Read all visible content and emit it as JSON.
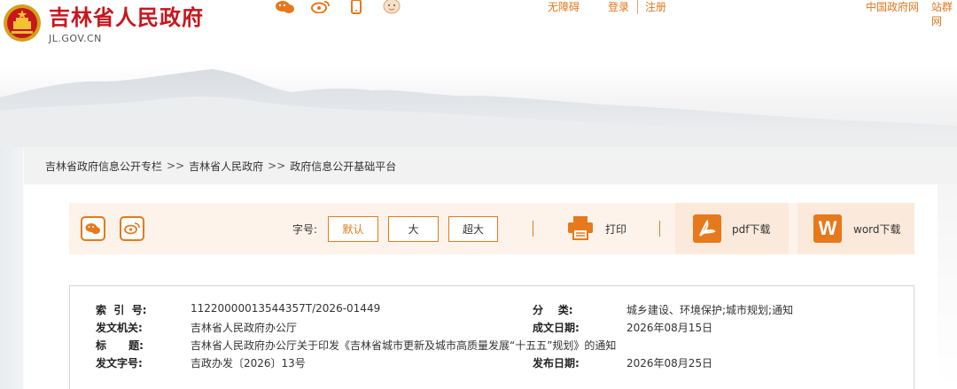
{
  "site": {
    "title": "吉林省人民政府",
    "domain": "JL.GOV.CN"
  },
  "top_icons": [
    "wechat-icon",
    "weibo-icon",
    "mobile-icon",
    "baby-face-icon"
  ],
  "top_links": {
    "accessibility": "无障碍",
    "login": "登录",
    "register": "注册",
    "gov_site": "中国政府网",
    "site_group": "站群网"
  },
  "breadcrumb": {
    "items": [
      "吉林省政府信息公开专栏",
      "吉林省人民政府",
      "政府信息公开基础平台"
    ],
    "separator": ">>"
  },
  "toolbar": {
    "font_label": "字号:",
    "font_default": "默认",
    "font_large": "大",
    "font_xlarge": "超大",
    "print": "打印",
    "pdf": "pdf下载",
    "word": "word下载",
    "word_letter": "W",
    "accent_color": "#e6791b"
  },
  "info": {
    "index_label": "索  引  号:",
    "index_value": "11220000013544357T/2026-01449",
    "category_label": "分    类:",
    "category_value": "城乡建设、环境保护;城市规划;通知",
    "issuer_label": "发文机关:",
    "issuer_value": "吉林省人民政府办公厅",
    "date_label": "成文日期:",
    "date_value": "2026年08月15日",
    "title_label": "标      题:",
    "title_value": "吉林省人民政府办公厅关于印发《吉林省城市更新及城市高质量发展“十五五”规划》的通知",
    "doc_no_label": "发文字号:",
    "doc_no_value": "吉政办发〔2026〕13号",
    "publish_label": "发布日期:",
    "publish_value": "2026年08月25日"
  },
  "colors": {
    "brand_red": "#c8161d",
    "orange": "#e6791b"
  }
}
